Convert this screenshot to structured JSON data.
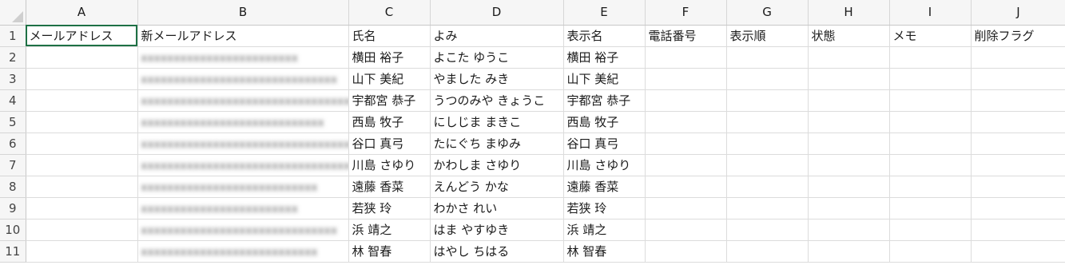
{
  "columns": [
    "A",
    "B",
    "C",
    "D",
    "E",
    "F",
    "G",
    "H",
    "I",
    "J"
  ],
  "rows": [
    {
      "num": "1",
      "cells": [
        "メールアドレス",
        "新メールアドレス",
        "氏名",
        "よみ",
        "表示名",
        "電話番号",
        "表示順",
        "状態",
        "メモ",
        "削除フラグ"
      ]
    },
    {
      "num": "2",
      "cells": [
        "",
        "",
        "横田 裕子",
        "よこた ゆうこ",
        "横田 裕子",
        "",
        "",
        "",
        "",
        ""
      ]
    },
    {
      "num": "3",
      "cells": [
        "",
        "",
        "山下 美紀",
        "やました みき",
        "山下 美紀",
        "",
        "",
        "",
        "",
        ""
      ]
    },
    {
      "num": "4",
      "cells": [
        "",
        "",
        "宇都宮 恭子",
        "うつのみや きょうこ",
        "宇都宮 恭子",
        "",
        "",
        "",
        "",
        ""
      ]
    },
    {
      "num": "5",
      "cells": [
        "",
        "",
        "西島 牧子",
        "にしじま まきこ",
        "西島 牧子",
        "",
        "",
        "",
        "",
        ""
      ]
    },
    {
      "num": "6",
      "cells": [
        "",
        "",
        "谷口 真弓",
        "たにぐち まゆみ",
        "谷口 真弓",
        "",
        "",
        "",
        "",
        ""
      ]
    },
    {
      "num": "7",
      "cells": [
        "",
        "",
        "川島 さゆり",
        "かわしま さゆり",
        "川島 さゆり",
        "",
        "",
        "",
        "",
        ""
      ]
    },
    {
      "num": "8",
      "cells": [
        "",
        "",
        "遠藤 香菜",
        "えんどう かな",
        "遠藤 香菜",
        "",
        "",
        "",
        "",
        ""
      ]
    },
    {
      "num": "9",
      "cells": [
        "",
        "",
        "若狭 玲",
        "わかさ れい",
        "若狭 玲",
        "",
        "",
        "",
        "",
        ""
      ]
    },
    {
      "num": "10",
      "cells": [
        "",
        "",
        "浜 靖之",
        "はま やすゆき",
        "浜 靖之",
        "",
        "",
        "",
        "",
        ""
      ]
    },
    {
      "num": "11",
      "cells": [
        "",
        "",
        "林 智春",
        "はやし ちはる",
        "林 智春",
        "",
        "",
        "",
        "",
        ""
      ]
    }
  ],
  "colors": {
    "selection_border": "#1e7145",
    "header_bg": "#f6f6f6",
    "gridline": "#dcdcdc"
  }
}
